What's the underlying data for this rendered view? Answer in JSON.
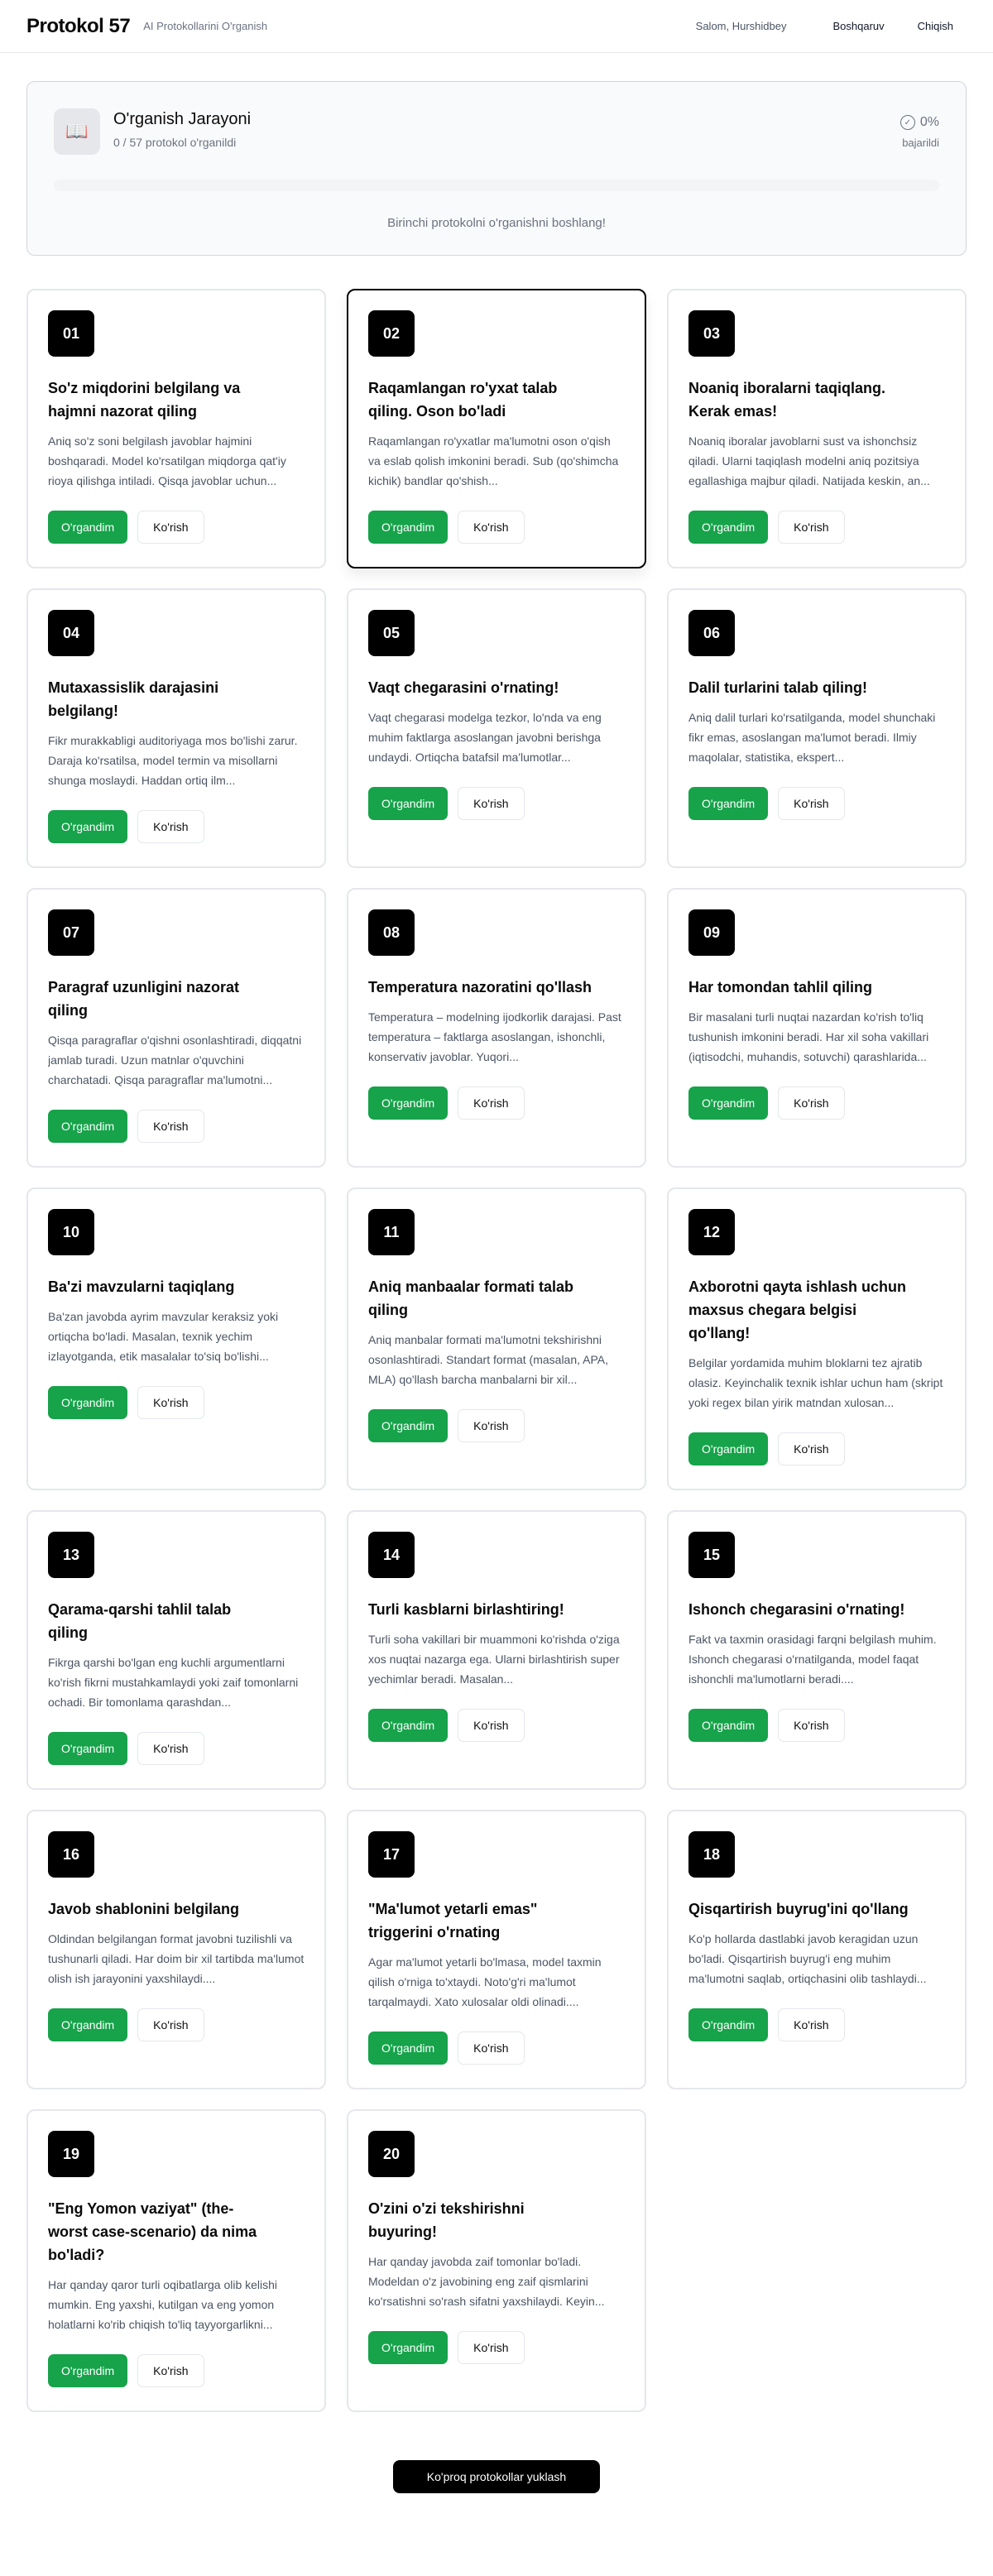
{
  "header": {
    "brand": "Protokol 57",
    "tagline": "AI Protokollarini O'rganish",
    "greeting": "Salom, Hurshidbey",
    "dashboard": "Boshqaruv",
    "logout": "Chiqish"
  },
  "progress": {
    "title": "O'rganish Jarayoni",
    "subtitle": "0 / 57 protokol o'rganildi",
    "percent": "0%",
    "percent_value": 0,
    "percent_label": "bajarildi",
    "message": "Birinchi protokolni o'rganishni boshlang!"
  },
  "buttons": {
    "learned": "O'rgandim",
    "view": "Ko'rish",
    "load_more": "Ko'proq protokollar yuklash"
  },
  "colors": {
    "accent": "#16a34a",
    "badge": "#000000"
  },
  "cards": [
    {
      "num": "01",
      "title": "So'z miqdorini belgilang va hajmni nazorat qiling",
      "desc": "Aniq so'z soni belgilash javoblar hajmini boshqaradi. Model ko'rsatilgan miqdorga qat'iy rioya qilishga intiladi. Qisqa javoblar uchun..."
    },
    {
      "num": "02",
      "title": "Raqamlangan ro'yxat talab qiling. Oson bo'ladi",
      "desc": "Raqamlangan ro'yxatlar ma'lumotni oson o'qish va eslab qolish imkonini beradi. Sub (qo'shimcha kichik) bandlar qo'shish..."
    },
    {
      "num": "03",
      "title": "Noaniq iboralarni taqiqlang. Kerak emas!",
      "desc": "Noaniq iboralar javoblarni sust va ishonchsiz qiladi. Ularni taqiqlash modelni aniq pozitsiya egallashiga majbur qiladi. Natijada keskin, an..."
    },
    {
      "num": "04",
      "title": "Mutaxassislik darajasini belgilang!",
      "desc": "Fikr murakkabligi auditoriyaga mos bo'lishi zarur. Daraja ko'rsatilsa, model termin va misollarni shunga moslaydi. Haddan ortiq ilm..."
    },
    {
      "num": "05",
      "title": "Vaqt chegarasini o'rnating!",
      "desc": "Vaqt chegarasi modelga tezkor, lo'nda va eng muhim faktlarga asoslangan javobni berishga undaydi. Ortiqcha batafsil ma'lumotlar..."
    },
    {
      "num": "06",
      "title": "Dalil turlarini talab qiling!",
      "desc": "Aniq dalil turlari ko'rsatilganda, model shunchaki fikr emas, asoslangan ma'lumot beradi. Ilmiy maqolalar, statistika, ekspert..."
    },
    {
      "num": "07",
      "title": "Paragraf uzunligini nazorat qiling",
      "desc": "Qisqa paragraflar o'qishni osonlashtiradi, diqqatni jamlab turadi. Uzun matnlar o'quvchini charchatadi. Qisqa paragraflar ma'lumotni..."
    },
    {
      "num": "08",
      "title": "Temperatura nazoratini qo'llash",
      "desc": "Temperatura – modelning ijodkorlik darajasi. Past temperatura – faktlarga asoslangan, ishonchli, konservativ javoblar. Yuqori..."
    },
    {
      "num": "09",
      "title": "Har tomondan tahlil qiling",
      "desc": "Bir masalani turli nuqtai nazardan ko'rish to'liq tushunish imkonini beradi. Har xil soha vakillari (iqtisodchi, muhandis, sotuvchi) qarashlarida..."
    },
    {
      "num": "10",
      "title": "Ba'zi mavzularni taqiqlang",
      "desc": "Ba'zan javobda ayrim mavzular keraksiz yoki ortiqcha bo'ladi. Masalan, texnik yechim izlayotganda, etik masalalar to'siq bo'lishi..."
    },
    {
      "num": "11",
      "title": "Aniq manbaalar formati talab qiling",
      "desc": "Aniq manbalar formati ma'lumotni tekshirishni osonlashtiradi. Standart format (masalan, APA, MLA) qo'llash barcha manbalarni bir xil..."
    },
    {
      "num": "12",
      "title": "Axborotni qayta ishlash uchun maxsus chegara belgisi qo'llang!",
      "desc": "Belgilar yordamida muhim bloklarni tez ajratib olasiz. Keyinchalik texnik ishlar uchun ham (skript yoki regex bilan yirik matndan xulosan..."
    },
    {
      "num": "13",
      "title": "Qarama-qarshi tahlil talab qiling",
      "desc": "Fikrga qarshi bo'lgan eng kuchli argumentlarni ko'rish fikrni mustahkamlaydi yoki zaif tomonlarni ochadi. Bir tomonlama qarashdan..."
    },
    {
      "num": "14",
      "title": "Turli kasblarni birlashtiring!",
      "desc": "Turli soha vakillari bir muammoni ko'rishda o'ziga xos nuqtai nazarga ega. Ularni birlashtirish super yechimlar beradi. Masalan..."
    },
    {
      "num": "15",
      "title": "Ishonch chegarasini o'rnating!",
      "desc": "Fakt va taxmin orasidagi farqni belgilash muhim. Ishonch chegarasi o'rnatilganda, model faqat ishonchli ma'lumotlarni beradi...."
    },
    {
      "num": "16",
      "title": "Javob shablonini belgilang",
      "desc": "Oldindan belgilangan format javobni tuzilishli va tushunarli qiladi. Har doim bir xil tartibda ma'lumot olish ish jarayonini yaxshilaydi...."
    },
    {
      "num": "17",
      "title": "\"Ma'lumot yetarli emas\" triggerini o'rnating",
      "desc": "Agar ma'lumot yetarli bo'lmasa, model taxmin qilish o'rniga to'xtaydi. Noto'g'ri ma'lumot tarqalmaydi. Xato xulosalar oldi olinadi...."
    },
    {
      "num": "18",
      "title": "Qisqartirish buyrug'ini qo'llang",
      "desc": "Ko'p hollarda dastlabki javob keragidan uzun bo'ladi. Qisqartirish buyrug'i eng muhim ma'lumotni saqlab, ortiqchasini olib tashlaydi..."
    },
    {
      "num": "19",
      "title": "\"Eng Yomon vaziyat\" (the-worst case-scenario) da nima bo'ladi?",
      "desc": "Har qanday qaror turli oqibatlarga olib kelishi mumkin. Eng yaxshi, kutilgan va eng yomon holatlarni ko'rib chiqish to'liq tayyorgarlikni..."
    },
    {
      "num": "20",
      "title": "O'zini o'zi tekshirishni buyuring!",
      "desc": "Har qanday javobda zaif tomonlar bo'ladi. Modeldan o'z javobining eng zaif qismlarini ko'rsatishni so'rash sifatni yaxshilaydi. Keyin..."
    }
  ]
}
